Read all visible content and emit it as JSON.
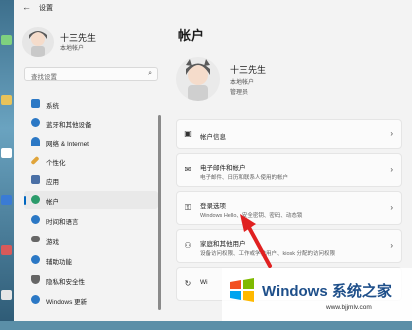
{
  "window": {
    "title": "设置",
    "back_icon": "back-arrow-icon"
  },
  "sidebar": {
    "profile_name": "十三先生",
    "profile_sub": "本地帐户",
    "search_placeholder": "查找设置",
    "items": [
      {
        "label": "系统",
        "icon": "system-icon",
        "color": "#2b78c5"
      },
      {
        "label": "蓝牙和其他设备",
        "icon": "bluetooth-icon",
        "color": "#2b78c5"
      },
      {
        "label": "网络 & Internet",
        "icon": "network-icon",
        "color": "#2b78c5"
      },
      {
        "label": "个性化",
        "icon": "personalization-icon",
        "color": "#e0a43a"
      },
      {
        "label": "应用",
        "icon": "apps-icon",
        "color": "#4a6fa5"
      },
      {
        "label": "帐户",
        "icon": "accounts-icon",
        "color": "#2b9b6b",
        "active": true
      },
      {
        "label": "时间和语言",
        "icon": "time-language-icon",
        "color": "#2b78c5"
      },
      {
        "label": "游戏",
        "icon": "gaming-icon",
        "color": "#666666"
      },
      {
        "label": "辅助功能",
        "icon": "accessibility-icon",
        "color": "#2b78c5"
      },
      {
        "label": "隐私和安全性",
        "icon": "privacy-shield-icon",
        "color": "#666666"
      },
      {
        "label": "Windows 更新",
        "icon": "windows-update-icon",
        "color": "#2b78c5"
      }
    ]
  },
  "main": {
    "title": "帐户",
    "profile_name": "十三先生",
    "profile_sub1": "本地帐户",
    "profile_sub2": "管理员",
    "cards": [
      {
        "title": "帐户信息",
        "subtitle": "",
        "icon": "account-info-icon"
      },
      {
        "title": "电子邮件和帐户",
        "subtitle": "电子邮件、日历和联系人使用的帐户",
        "icon": "email-icon"
      },
      {
        "title": "登录选项",
        "subtitle": "Windows Hello、安全密钥、密码、动态锁",
        "icon": "key-icon"
      },
      {
        "title": "家庭和其他用户",
        "subtitle": "设备访问权限、工作或学校用户、kiosk 分配的访问权限",
        "icon": "family-icon"
      },
      {
        "title": "Wi",
        "subtitle": "",
        "icon": "windows-backup-icon"
      }
    ]
  },
  "watermark": {
    "title": "Windows 系统之家",
    "url": "www.bjjmlv.com"
  },
  "colors": {
    "accent": "#0067c0",
    "arrow": "#e02020"
  }
}
